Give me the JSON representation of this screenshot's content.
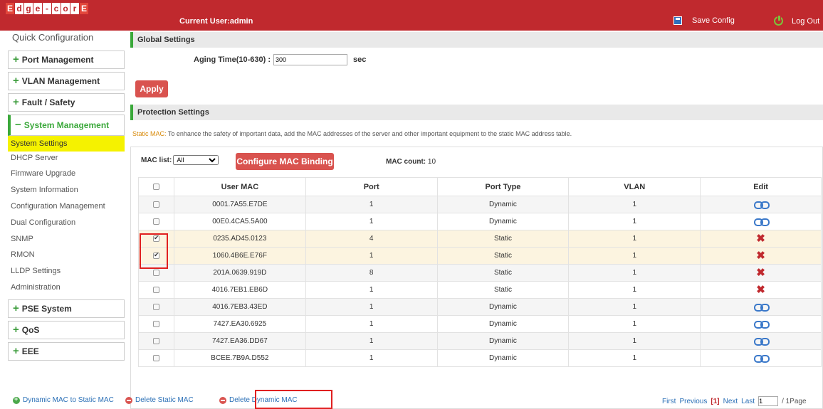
{
  "header": {
    "logo_letters": [
      "E",
      "d",
      "g",
      "e",
      "-",
      "c",
      "o",
      "r",
      "E"
    ],
    "current_user": "Current User:admin",
    "save_config": "Save Config",
    "log_out": "Log Out"
  },
  "sidebar": {
    "quick_config": "Quick Configuration",
    "groups": {
      "port": "Port Management",
      "vlan": "VLAN Management",
      "fault": "Fault / Safety",
      "system": "System Management",
      "pse": "PSE System",
      "qos": "QoS",
      "eee": "EEE"
    },
    "plus": "+",
    "minus": "−",
    "system_items": [
      "System Settings",
      "DHCP Server",
      "Firmware Upgrade",
      "System Information",
      "Configuration Management",
      "Dual Configuration",
      "SNMP",
      "RMON",
      "LLDP Settings",
      "Administration"
    ]
  },
  "global": {
    "title": "Global Settings",
    "aging_label": "Aging Time(10-630) :",
    "aging_value": "300",
    "aging_unit": "sec",
    "apply": "Apply"
  },
  "protection": {
    "title": "Protection Settings",
    "note_key": "Static MAC:",
    "note_text": " To enhance the safety of important data, add the MAC addresses of the server and other important equipment to the static MAC address table."
  },
  "mac": {
    "list_label": "MAC list:",
    "list_value": "All",
    "configure_btn": "Configure MAC Binding",
    "count_label": "MAC count:",
    "count_value": "10",
    "columns": [
      "User MAC",
      "Port",
      "Port Type",
      "VLAN",
      "Edit"
    ],
    "rows": [
      {
        "mac": "0001.7A55.E7DE",
        "port": "1",
        "type": "Dynamic",
        "vlan": "1",
        "checked": false,
        "edit": "link-icon"
      },
      {
        "mac": "00E0.4CA5.5A00",
        "port": "1",
        "type": "Dynamic",
        "vlan": "1",
        "checked": false,
        "edit": "link-icon"
      },
      {
        "mac": "0235.AD45.0123",
        "port": "4",
        "type": "Static",
        "vlan": "1",
        "checked": true,
        "edit": "delete-icon"
      },
      {
        "mac": "1060.4B6E.E76F",
        "port": "1",
        "type": "Static",
        "vlan": "1",
        "checked": true,
        "edit": "delete-icon"
      },
      {
        "mac": "201A.0639.919D",
        "port": "8",
        "type": "Static",
        "vlan": "1",
        "checked": false,
        "edit": "delete-icon"
      },
      {
        "mac": "4016.7EB1.EB6D",
        "port": "1",
        "type": "Static",
        "vlan": "1",
        "checked": false,
        "edit": "delete-icon"
      },
      {
        "mac": "4016.7EB3.43ED",
        "port": "1",
        "type": "Dynamic",
        "vlan": "1",
        "checked": false,
        "edit": "link-icon"
      },
      {
        "mac": "7427.EA30.6925",
        "port": "1",
        "type": "Dynamic",
        "vlan": "1",
        "checked": false,
        "edit": "link-icon"
      },
      {
        "mac": "7427.EA36.DD67",
        "port": "1",
        "type": "Dynamic",
        "vlan": "1",
        "checked": false,
        "edit": "link-icon"
      },
      {
        "mac": "BCEE.7B9A.D552",
        "port": "1",
        "type": "Dynamic",
        "vlan": "1",
        "checked": false,
        "edit": "link-icon"
      }
    ]
  },
  "footer": {
    "dyn_to_static": "Dynamic MAC to Static MAC",
    "delete_static": "Delete Static MAC",
    "delete_dynamic": "Delete Dynamic MAC",
    "first": "First",
    "previous": "Previous",
    "current_page": "[1]",
    "next": "Next",
    "last": "Last",
    "page_input": "1",
    "total": "/ 1Page"
  },
  "colors": {
    "brand_red": "#c0292e",
    "accent_green": "#3aa83a",
    "selected_yellow": "#f5f200",
    "highlight_box": "#e02020"
  }
}
